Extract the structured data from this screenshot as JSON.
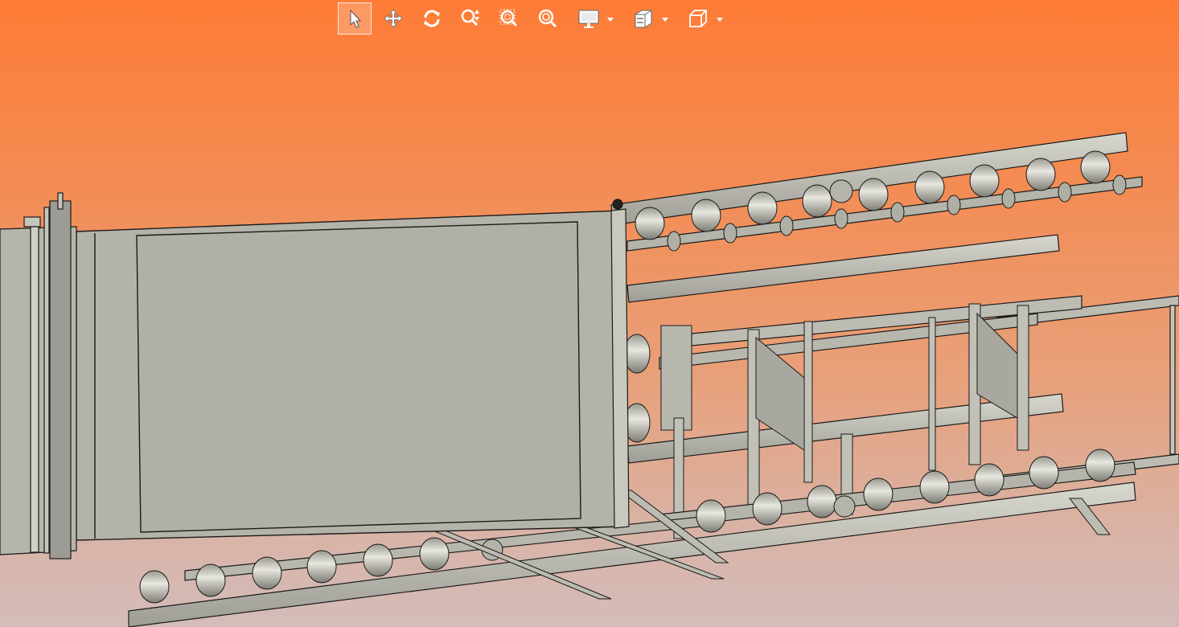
{
  "app": {
    "window_title": ""
  },
  "colors": {
    "bg_top": "#fe7c36",
    "bg_bottom": "#d4bcba",
    "metal": "#c7c6bd",
    "metal_dark": "#8f8e86",
    "outline": "#1a1a1a",
    "icon": "#ffffff"
  },
  "toolbar": {
    "items": [
      {
        "name": "select-tool",
        "icon": "arrow-pointer-icon",
        "active": true
      },
      {
        "name": "pan-tool",
        "icon": "move-arrows-icon",
        "active": false
      },
      {
        "name": "rotate-tool",
        "icon": "rotate-icon",
        "active": false
      },
      {
        "name": "zoom-tool",
        "icon": "zoom-updown-icon",
        "active": false
      },
      {
        "name": "zoom-window-tool",
        "icon": "zoom-window-icon",
        "active": false
      },
      {
        "name": "zoom-fit-tool",
        "icon": "zoom-fit-icon",
        "active": false
      },
      {
        "name": "display-mode",
        "icon": "monitor-icon",
        "has_dropdown": true
      },
      {
        "name": "section-view",
        "icon": "section-cube-icon",
        "has_dropdown": true
      },
      {
        "name": "standard-views",
        "icon": "cube-icon",
        "has_dropdown": true
      }
    ]
  },
  "scene": {
    "model": "conveyor-assembly",
    "shading": "shaded-with-edges"
  }
}
